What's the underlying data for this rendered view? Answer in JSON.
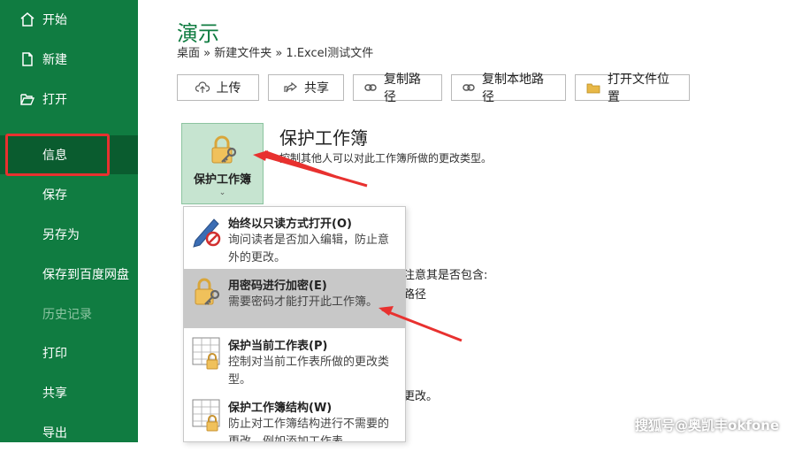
{
  "sidebar": {
    "items": [
      {
        "label": "开始",
        "icon": "home-icon"
      },
      {
        "label": "新建",
        "icon": "new-file-icon"
      },
      {
        "label": "打开",
        "icon": "open-folder-icon"
      },
      {
        "label": "信息"
      },
      {
        "label": "保存"
      },
      {
        "label": "另存为"
      },
      {
        "label": "保存到百度网盘"
      },
      {
        "label": "历史记录"
      },
      {
        "label": "打印"
      },
      {
        "label": "共享"
      },
      {
        "label": "导出"
      }
    ],
    "bg_color": "#107c41",
    "active_color": "#0a5c2f"
  },
  "main": {
    "title": "演示",
    "breadcrumb": "桌面 » 新建文件夹 » 1.Excel测试文件",
    "actions": [
      {
        "label": "上传",
        "icon": "upload-icon"
      },
      {
        "label": "共享",
        "icon": "share-icon"
      },
      {
        "label": "复制路径",
        "icon": "link-icon"
      },
      {
        "label": "复制本地路径",
        "icon": "link-icon"
      },
      {
        "label": "打开文件位置",
        "icon": "folder-icon"
      }
    ],
    "protect": {
      "button_label": "保护工作簿",
      "title": "保护工作簿",
      "description": "控制其他人可以对此工作簿所做的更改类型。"
    },
    "background_fragments": {
      "line1": "注意其是否包含:",
      "line2": "路径",
      "line3": "更改。"
    }
  },
  "dropdown": {
    "items": [
      {
        "title": "始终以只读方式打开(O)",
        "desc": "询问读者是否加入编辑，防止意外的更改。",
        "icon": "pencil-no-icon"
      },
      {
        "title": "用密码进行加密(E)",
        "desc": "需要密码才能打开此工作簿。",
        "icon": "lock-key-icon"
      },
      {
        "title": "保护当前工作表(P)",
        "desc": "控制对当前工作表所做的更改类型。",
        "icon": "sheet-lock-icon"
      },
      {
        "title": "保护工作簿结构(W)",
        "desc": "防止对工作簿结构进行不需要的更改，例如添加工作表。",
        "icon": "sheet-lock-icon"
      }
    ]
  },
  "watermark": "搜狐号@奥凯丰okfone",
  "colors": {
    "accent": "#107c41",
    "highlight": "#e8312f"
  }
}
